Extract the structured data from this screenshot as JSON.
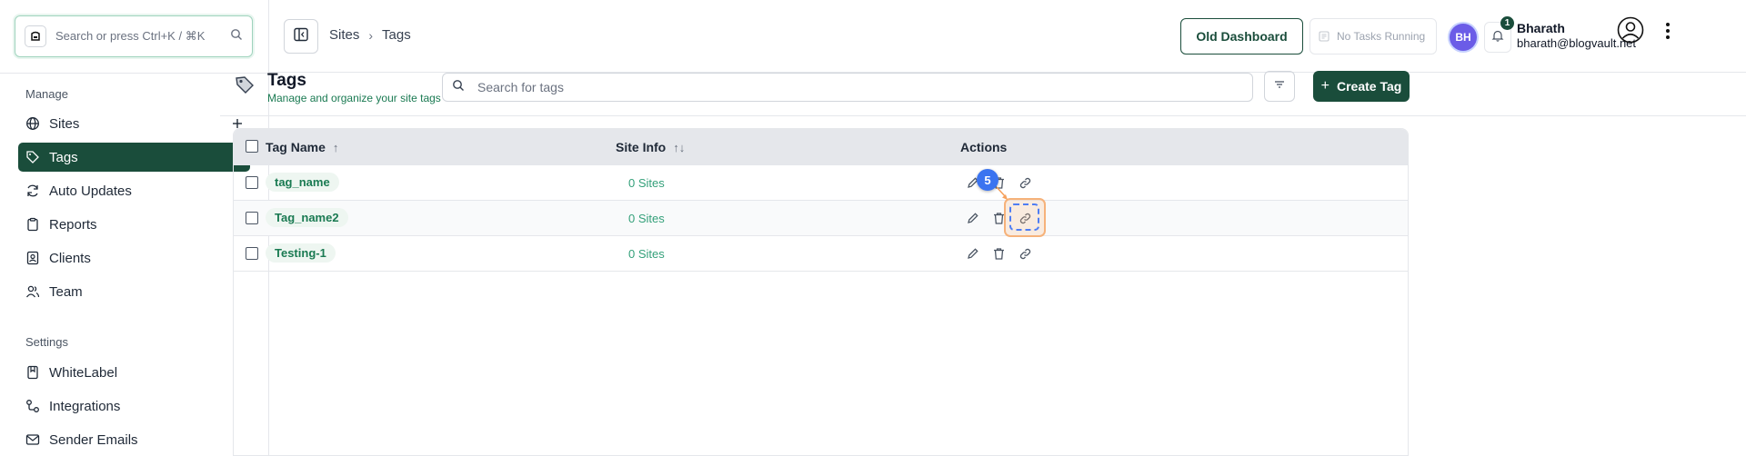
{
  "sidebar": {
    "search_placeholder": "Search or press Ctrl+K / ⌘K",
    "manage_label": "Manage",
    "manage_items": [
      {
        "label": "Sites",
        "icon": "globe-icon"
      },
      {
        "label": "Tags",
        "icon": "tag-icon",
        "active": true
      },
      {
        "label": "Auto Updates",
        "icon": "refresh-icon"
      },
      {
        "label": "Reports",
        "icon": "clipboard-icon"
      },
      {
        "label": "Clients",
        "icon": "contact-icon"
      },
      {
        "label": "Team",
        "icon": "users-icon"
      }
    ],
    "settings_label": "Settings",
    "settings_items": [
      {
        "label": "WhiteLabel",
        "icon": "bookmark-icon"
      },
      {
        "label": "Integrations",
        "icon": "integrations-icon"
      },
      {
        "label": "Sender Emails",
        "icon": "mail-icon"
      }
    ]
  },
  "header": {
    "breadcrumb": [
      "Sites",
      "Tags"
    ],
    "old_dashboard": "Old Dashboard",
    "tasks_status": "No Tasks Running",
    "avatar_initials": "BH",
    "notification_count": "1",
    "user_name": "Bharath",
    "user_email": "bharath@blogvault.net"
  },
  "page": {
    "title": "Tags",
    "subtitle": "Manage and organize your site tags",
    "search_placeholder": "Search for tags",
    "create_label": "Create Tag"
  },
  "table": {
    "columns": [
      "Tag Name",
      "Site Info",
      "Actions"
    ],
    "rows": [
      {
        "name": "tag_name",
        "sites": "0 Sites"
      },
      {
        "name": "Tag_name2",
        "sites": "0 Sites"
      },
      {
        "name": "Testing-1",
        "sites": "0 Sites"
      }
    ]
  },
  "annotation": {
    "step": "5"
  },
  "colors": {
    "accent": "#1a4d3b",
    "link_green": "#1a7a52",
    "highlight": "#f6b27a",
    "step_blue": "#3b74f0"
  }
}
